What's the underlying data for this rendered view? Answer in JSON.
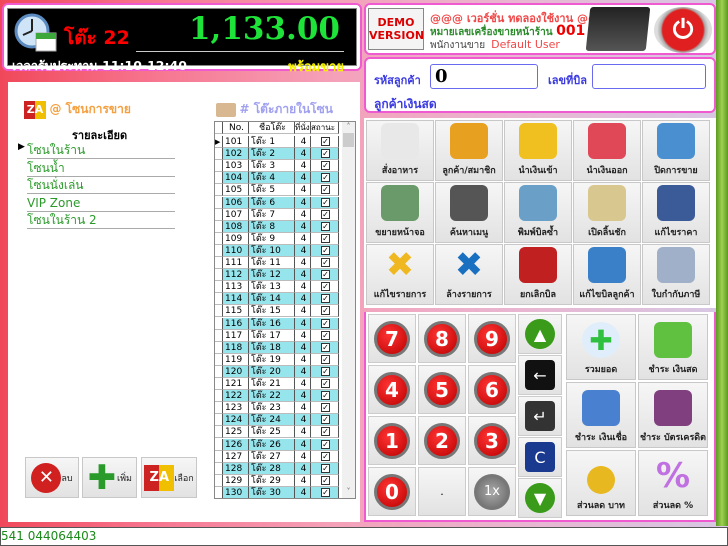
{
  "header": {
    "table_label": "โต๊ะ 22",
    "amount": "1,133.00",
    "time_label": "เวลารับประทาน 11:10-12:40",
    "status": "พร้อมขาย"
  },
  "info": {
    "demo_badge": "DEMO VERSION",
    "version_text": "@@@ เวอร์ชั่น ทดลองใช้งาน @@@",
    "terminal_label": "หมายเลขเครื่องขายหน้าร้าน",
    "terminal_no": "001",
    "employee_label": "พนักงานขาย",
    "employee": "Default User"
  },
  "customer": {
    "code_label": "รหัสลูกค้า",
    "code_value": "0",
    "bill_label": "เลขที่บิล",
    "bill_value": "",
    "customer_name": "ลูกค้าเงินสด"
  },
  "zones": {
    "title": "@ โซนการขาย",
    "header": "รายละเอียด",
    "items": [
      "โซนในร้าน",
      "โซนน้ำ",
      "โซนนั่งเล่น",
      "VIP Zone",
      "โซนในร้าน 2"
    ]
  },
  "tables": {
    "title": "# โต๊ะภายในโซน",
    "columns": [
      "No.",
      "ชื่อโต๊ะ",
      "ที่นั่ง",
      "สถานะ"
    ],
    "rows": [
      [
        "101",
        "โต๊ะ 1",
        "4"
      ],
      [
        "102",
        "โต๊ะ 2",
        "4"
      ],
      [
        "103",
        "โต๊ะ 3",
        "4"
      ],
      [
        "104",
        "โต๊ะ 4",
        "4"
      ],
      [
        "105",
        "โต๊ะ 5",
        "4"
      ],
      [
        "106",
        "โต๊ะ 6",
        "4"
      ],
      [
        "107",
        "โต๊ะ 7",
        "4"
      ],
      [
        "108",
        "โต๊ะ 8",
        "4"
      ],
      [
        "109",
        "โต๊ะ 9",
        "4"
      ],
      [
        "110",
        "โต๊ะ 10",
        "4"
      ],
      [
        "111",
        "โต๊ะ 11",
        "4"
      ],
      [
        "112",
        "โต๊ะ 12",
        "4"
      ],
      [
        "113",
        "โต๊ะ 13",
        "4"
      ],
      [
        "114",
        "โต๊ะ 14",
        "4"
      ],
      [
        "115",
        "โต๊ะ 15",
        "4"
      ],
      [
        "116",
        "โต๊ะ 16",
        "4"
      ],
      [
        "117",
        "โต๊ะ 17",
        "4"
      ],
      [
        "118",
        "โต๊ะ 18",
        "4"
      ],
      [
        "119",
        "โต๊ะ 19",
        "4"
      ],
      [
        "120",
        "โต๊ะ 20",
        "4"
      ],
      [
        "121",
        "โต๊ะ 21",
        "4"
      ],
      [
        "122",
        "โต๊ะ 22",
        "4"
      ],
      [
        "123",
        "โต๊ะ 23",
        "4"
      ],
      [
        "124",
        "โต๊ะ 24",
        "4"
      ],
      [
        "125",
        "โต๊ะ 25",
        "4"
      ],
      [
        "126",
        "โต๊ะ 26",
        "4"
      ],
      [
        "127",
        "โต๊ะ 27",
        "4"
      ],
      [
        "128",
        "โต๊ะ 28",
        "4"
      ],
      [
        "129",
        "โต๊ะ 29",
        "4"
      ],
      [
        "130",
        "โต๊ะ 30",
        "4"
      ]
    ]
  },
  "zone_buttons": {
    "delete": "ลบ",
    "add": "เพิ่ม",
    "select": "เลือก"
  },
  "functions": [
    {
      "label": "สั่งอาหาร",
      "icon": "menu-grid-icon",
      "color": "#e8e8e8"
    },
    {
      "label": "ลูกค้า/สมาชิก",
      "icon": "members-icon",
      "color": "#e8a020"
    },
    {
      "label": "นำเงินเข้า",
      "icon": "money-in-icon",
      "color": "#f0c020"
    },
    {
      "label": "นำเงินออก",
      "icon": "money-out-icon",
      "color": "#e04858"
    },
    {
      "label": "ปิดการขาย",
      "icon": "clock-calendar-icon",
      "color": "#4a90d0"
    },
    {
      "label": "ขยายหน้าจอ",
      "icon": "expand-screen-icon",
      "color": "#6a9a6a"
    },
    {
      "label": "ค้นหาเมนู",
      "icon": "barcode-icon",
      "color": "#555555"
    },
    {
      "label": "พิมพ์บิลซ้ำ",
      "icon": "printer-icon",
      "color": "#6aa0c8"
    },
    {
      "label": "เปิดลิ้นชัก",
      "icon": "cash-register-icon",
      "color": "#d8c890"
    },
    {
      "label": "แก้ไขราคา",
      "icon": "price-tag-icon",
      "color": "#3a5a98"
    },
    {
      "label": "แก้ไขรายการ",
      "icon": "yellow-x-icon",
      "color": "#f0b820"
    },
    {
      "label": "ล้างรายการ",
      "icon": "blue-x-icon",
      "color": "#1a70c0"
    },
    {
      "label": "ยกเลิกบิล",
      "icon": "cancel-bill-icon",
      "color": "#c02020"
    },
    {
      "label": "แก้ไขบิลลูกค้า",
      "icon": "customer-folder-icon",
      "color": "#3a80c8"
    },
    {
      "label": "ใบกำกับภาษี",
      "icon": "tax-invoice-icon",
      "color": "#a0b0c8"
    }
  ],
  "keypad": {
    "keys": [
      "7",
      "8",
      "9",
      "4",
      "5",
      "6",
      "1",
      "2",
      "3",
      "0",
      ".",
      "1x"
    ],
    "clear": "C"
  },
  "payments": [
    {
      "label": "รวมยอด",
      "icon": "plus-icon",
      "color": "#30c040"
    },
    {
      "label": "ชำระ เงินสด",
      "icon": "cash-icon",
      "color": "#60c040"
    },
    {
      "label": "ชำระ เงินเชื่อ",
      "icon": "credit-icon",
      "color": "#4a80d0"
    },
    {
      "label": "ชำระ บัตรเครดิต",
      "icon": "credit-card-icon",
      "color": "#804080"
    },
    {
      "label": "ส่วนลด บาท",
      "icon": "coin-icon",
      "color": "#e8b820"
    },
    {
      "label": "ส่วนลด %",
      "icon": "percent-icon",
      "color": "#c070e0"
    }
  ],
  "statusbar": {
    "text": "541 044064403"
  }
}
